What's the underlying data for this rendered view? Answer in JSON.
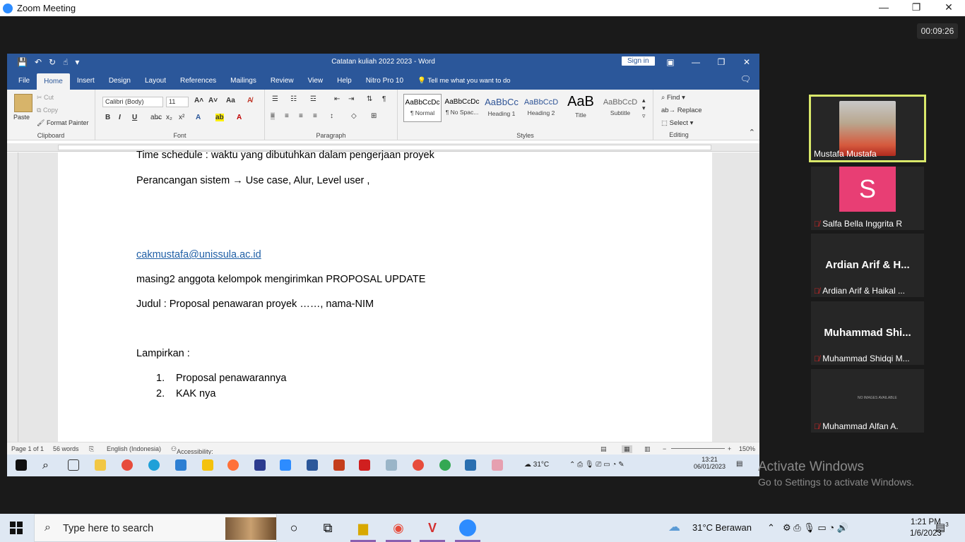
{
  "zoom": {
    "title": "Zoom Meeting",
    "timer": "00:09:26",
    "window_controls": [
      "—",
      "❐",
      "✕"
    ]
  },
  "word": {
    "doc_title": "Catatan kuliah 2022 2023  -  Word",
    "sign_in": "Sign in",
    "tabs": [
      "File",
      "Home",
      "Insert",
      "Design",
      "Layout",
      "References",
      "Mailings",
      "Review",
      "View",
      "Help",
      "Nitro Pro 10"
    ],
    "tell_me": "Tell me what you want to do",
    "clipboard": {
      "paste": "Paste",
      "cut": "Cut",
      "copy": "Copy",
      "format_painter": "Format Painter",
      "label": "Clipboard"
    },
    "font": {
      "name": "Calibri (Body)",
      "size": "11",
      "label": "Font"
    },
    "paragraph_label": "Paragraph",
    "styles": [
      {
        "preview": "AaBbCcDc",
        "name": "¶ Normal"
      },
      {
        "preview": "AaBbCcDc",
        "name": "¶ No Spac..."
      },
      {
        "preview": "AaBbCc",
        "name": "Heading 1"
      },
      {
        "preview": "AaBbCcD",
        "name": "Heading 2"
      },
      {
        "preview": "AaB",
        "name": "Title"
      },
      {
        "preview": "AaBbCcD",
        "name": "Subtitle"
      }
    ],
    "styles_label": "Styles",
    "editing": {
      "find": "Find",
      "replace": "Replace",
      "select": "Select",
      "label": "Editing"
    },
    "document": {
      "line1": "Time schedule : waktu yang dibutuhkan dalam pengerjaan proyek",
      "line2": "Perancangan sistem → Use case, Alur, Level user ,",
      "email": "cakmustafa@unissula.ac.id",
      "line4": "masing2 anggota kelompok mengirimkan PROPOSAL UPDATE",
      "line5": "Judul : Proposal penawaran proyek ……, nama-NIM",
      "line6": "Lampirkan :",
      "list": [
        {
          "num": "1.",
          "text": "Proposal penawarannya"
        },
        {
          "num": "2.",
          "text": "KAK nya"
        }
      ]
    },
    "status": {
      "page": "Page 1 of 1",
      "words": "56 words",
      "language": "English (Indonesia)",
      "accessibility": "Accessibility: Good to go",
      "zoom": "150%"
    },
    "inner_taskbar": {
      "weather": "31°C",
      "time": "13:21",
      "date": "06/01/2023"
    }
  },
  "participants": [
    {
      "name": "Mustafa Mustafa",
      "muted": false,
      "type": "video"
    },
    {
      "name": "Salfa Bella Inggrita R",
      "muted": true,
      "type": "avatar",
      "initial": "S"
    },
    {
      "name": "Ardian Arif & Haikal ...",
      "display": "Ardian Arif & H...",
      "muted": true,
      "type": "text"
    },
    {
      "name": "Muhammad Shidqi M...",
      "display": "Muhammad  Shi...",
      "muted": true,
      "type": "text"
    },
    {
      "name": "Muhammad Alfan A.",
      "muted": true,
      "type": "noimage",
      "placeholder": "NO IMAGES AVAILABLE"
    }
  ],
  "watermark": {
    "line1": "Activate Windows",
    "line2": "Go to Settings to activate Windows."
  },
  "taskbar": {
    "search_placeholder": "Type here to search",
    "weather": "31°C  Berawan",
    "time": "1:21 PM",
    "date": "1/6/2023",
    "notifications": "3"
  },
  "colors": {
    "word_blue": "#2b579a",
    "zoom_blue": "#2d8cff",
    "active_speaker": "#d9e86a",
    "muted_red": "#e02828"
  }
}
